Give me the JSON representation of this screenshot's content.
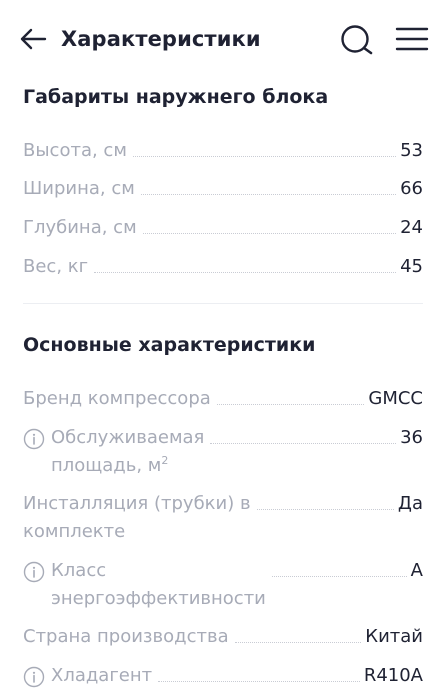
{
  "header": {
    "title": "Характеристики",
    "back_icon": "arrow-left-icon",
    "search_icon": "search-icon",
    "menu_icon": "menu-icon"
  },
  "sections": [
    {
      "title": "Габариты наружнего блока",
      "rows": [
        {
          "label": "Высота, см",
          "value": "53"
        },
        {
          "label": "Ширина, см",
          "value": "66"
        },
        {
          "label": "Глубина, см",
          "value": "24"
        },
        {
          "label": "Вес, кг",
          "value": "45"
        }
      ]
    },
    {
      "title": "Основные характеристики",
      "rows": [
        {
          "label": "Бренд компрессора",
          "value": "GMCC"
        },
        {
          "label": "Обслуживаемая",
          "label2": "площадь, м",
          "label2_sup": "2",
          "value": "36",
          "info": true
        },
        {
          "label": "Инсталляция (трубки) в",
          "label2": "комплекте",
          "value": "Да"
        },
        {
          "label": "Класс",
          "label2": "энергоэффективности",
          "value": "А",
          "info": true
        },
        {
          "label": "Страна производства",
          "value": "Китай"
        },
        {
          "label": "Хладагент",
          "value": "R410A",
          "info": true
        }
      ]
    }
  ],
  "colors": {
    "text_primary": "#1f2233",
    "text_secondary": "#a7abb7",
    "leader_dots": "#c9ccd4",
    "divider": "#eceef2"
  }
}
